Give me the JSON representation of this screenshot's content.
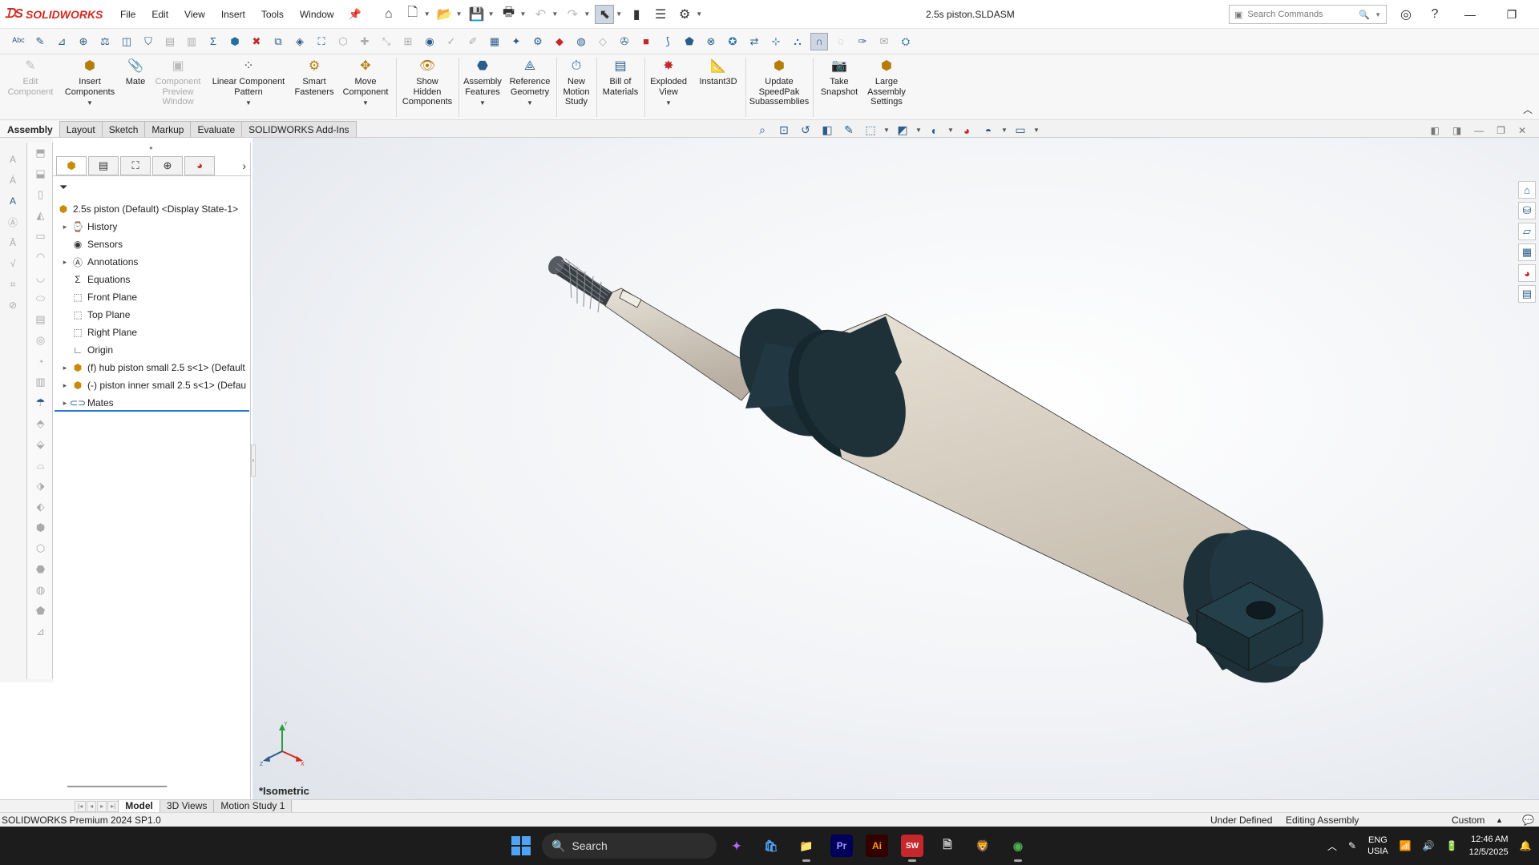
{
  "app": {
    "brand": "SOLIDWORKS",
    "document_title": "2.5s piston.SLDASM"
  },
  "menus": [
    "File",
    "Edit",
    "View",
    "Insert",
    "Tools",
    "Window"
  ],
  "search": {
    "placeholder": "Search Commands"
  },
  "commands": [
    {
      "label": "Edit\nComponent",
      "icon": "edit-component-icon",
      "enabled": false
    },
    {
      "label": "Insert\nComponents",
      "icon": "insert-components-icon",
      "enabled": true,
      "dropdown": true
    },
    {
      "label": "Mate",
      "icon": "mate-icon",
      "enabled": true
    },
    {
      "label": "Component\nPreview\nWindow",
      "icon": "preview-window-icon",
      "enabled": false
    },
    {
      "label": "Linear Component\nPattern",
      "icon": "linear-pattern-icon",
      "enabled": true,
      "dropdown": true
    },
    {
      "label": "Smart\nFasteners",
      "icon": "smart-fasteners-icon",
      "enabled": true
    },
    {
      "label": "Move\nComponent",
      "icon": "move-component-icon",
      "enabled": true,
      "dropdown": true
    },
    {
      "label": "Show\nHidden\nComponents",
      "icon": "show-hidden-icon",
      "enabled": true
    },
    {
      "label": "Assembly\nFeatures",
      "icon": "assembly-features-icon",
      "enabled": true,
      "dropdown": true
    },
    {
      "label": "Reference\nGeometry",
      "icon": "reference-geometry-icon",
      "enabled": true,
      "dropdown": true
    },
    {
      "label": "New\nMotion\nStudy",
      "icon": "motion-study-icon",
      "enabled": true
    },
    {
      "label": "Bill of\nMaterials",
      "icon": "bom-icon",
      "enabled": true
    },
    {
      "label": "Exploded\nView",
      "icon": "exploded-view-icon",
      "enabled": true,
      "dropdown": true
    },
    {
      "label": "Instant3D",
      "icon": "instant3d-icon",
      "enabled": true
    },
    {
      "label": "Update\nSpeedPak\nSubassemblies",
      "icon": "speedpak-icon",
      "enabled": true
    },
    {
      "label": "Take\nSnapshot",
      "icon": "snapshot-icon",
      "enabled": true
    },
    {
      "label": "Large\nAssembly\nSettings",
      "icon": "large-assembly-icon",
      "enabled": true
    }
  ],
  "tabs": [
    "Assembly",
    "Layout",
    "Sketch",
    "Markup",
    "Evaluate",
    "SOLIDWORKS Add-Ins"
  ],
  "active_tab": "Assembly",
  "tree": {
    "root": "2.5s piston (Default) <Display State-1>",
    "items": [
      {
        "label": "History",
        "icon": "history-icon",
        "expandable": true
      },
      {
        "label": "Sensors",
        "icon": "sensors-icon",
        "expandable": false
      },
      {
        "label": "Annotations",
        "icon": "annotations-icon",
        "expandable": true
      },
      {
        "label": "Equations",
        "icon": "equations-icon",
        "expandable": false
      },
      {
        "label": "Front Plane",
        "icon": "plane-icon",
        "expandable": false
      },
      {
        "label": "Top Plane",
        "icon": "plane-icon",
        "expandable": false
      },
      {
        "label": "Right Plane",
        "icon": "plane-icon",
        "expandable": false
      },
      {
        "label": "Origin",
        "icon": "origin-icon",
        "expandable": false
      },
      {
        "label": "(f) hub piston small 2.5 s<1> (Default",
        "icon": "part-icon",
        "expandable": true
      },
      {
        "label": "(-) piston inner small 2.5 s<1> (Defau",
        "icon": "part-icon",
        "expandable": true
      },
      {
        "label": "Mates",
        "icon": "mates-icon",
        "expandable": true
      }
    ]
  },
  "viewport": {
    "view_label": "*Isometric",
    "triad": {
      "x": "X",
      "y": "Y",
      "z": "Z"
    }
  },
  "bottom_tabs": [
    "Model",
    "3D Views",
    "Motion Study 1"
  ],
  "active_bottom_tab": "Model",
  "status": {
    "version": "SOLIDWORKS Premium 2024 SP1.0",
    "definition": "Under Defined",
    "mode": "Editing Assembly",
    "units": "Custom"
  },
  "taskbar": {
    "search_label": "Search",
    "apps": [
      "Copilot",
      "Microsoft Store",
      "File Explorer",
      "Premiere Pro",
      "Illustrator",
      "SOLIDWORKS 2024",
      "Notepad",
      "Brave",
      "Chrome"
    ],
    "lang": "ENG",
    "region": "USIA",
    "time": "12:46 AM",
    "date": "12/5/2025"
  },
  "colors": {
    "brand_red": "#d12a1f",
    "accent_blue": "#2b5c8a",
    "cylinder_body": "#d6cec2",
    "cylinder_caps": "#1e3139"
  }
}
